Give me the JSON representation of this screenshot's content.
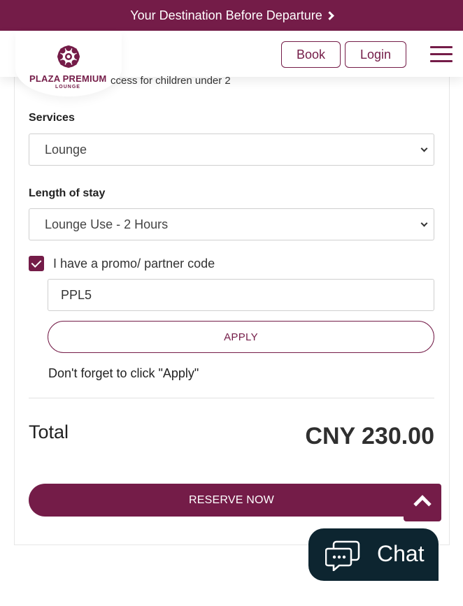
{
  "banner": {
    "text": "Your Destination Before Departure"
  },
  "header": {
    "logo_name": "PLAZA PREMIUM",
    "logo_sub": "LOUNGE",
    "book_label": "Book",
    "login_label": "Login"
  },
  "form": {
    "note_text": "ccess for children under 2",
    "services_label": "Services",
    "services_value": "Lounge",
    "stay_label": "Length of stay",
    "stay_value": "Lounge Use - 2 Hours",
    "promo_checkbox_label": "I have a promo/ partner code",
    "promo_checked": true,
    "promo_value": "PPL5",
    "apply_label": "APPLY",
    "reminder": "Don't forget to click \"Apply\""
  },
  "summary": {
    "total_label": "Total",
    "total_value": "CNY 230.00"
  },
  "actions": {
    "reserve_label": "RESERVE NOW",
    "chat_label": "Chat"
  },
  "colors": {
    "brand": "#741c48",
    "chat_bg": "#0d2530"
  },
  "icons": [
    "chevron-right-icon",
    "lotus-logo-icon",
    "hamburger-icon",
    "chevron-down-icon",
    "checkmark-icon",
    "arrow-up-icon",
    "chat-bubble-icon"
  ]
}
